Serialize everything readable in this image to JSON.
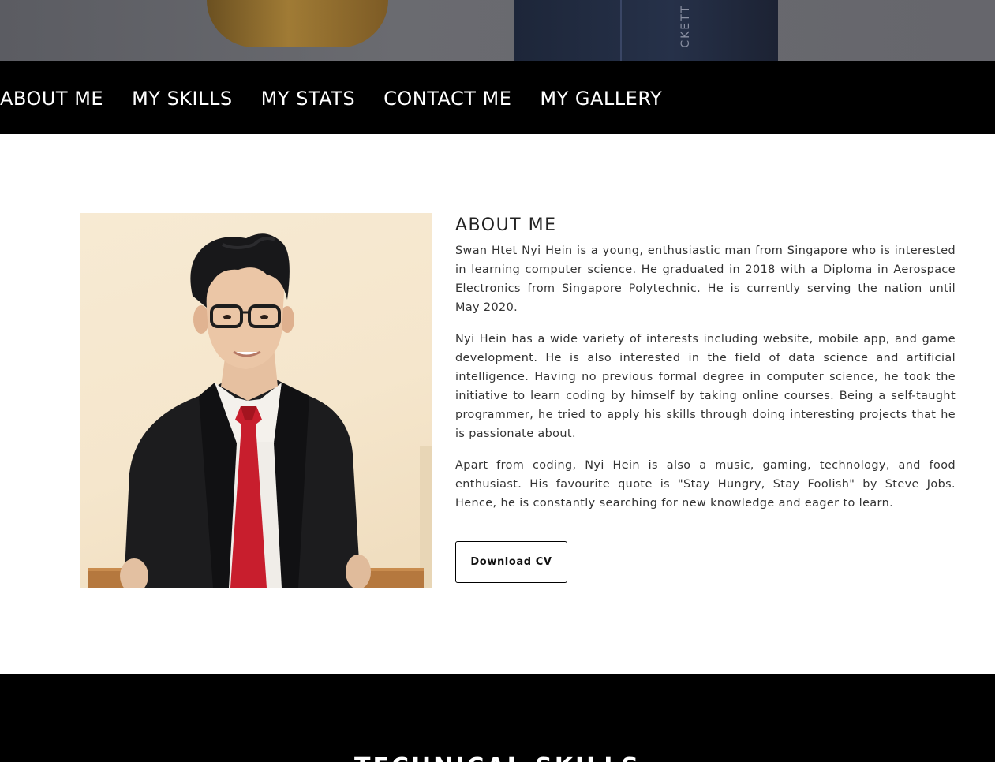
{
  "hero": {
    "book_spine_text": "CKETT"
  },
  "nav": {
    "items": [
      {
        "label": "ABOUT ME"
      },
      {
        "label": "MY SKILLS"
      },
      {
        "label": "MY STATS"
      },
      {
        "label": "CONTACT ME"
      },
      {
        "label": "MY GALLERY"
      }
    ]
  },
  "about": {
    "title": "ABOUT ME",
    "paragraphs": [
      "Swan Htet Nyi Hein is a young, enthusiastic man from Singapore who is interested in learning computer science. He graduated in 2018 with a Diploma in Aerospace Electronics from Singapore Polytechnic. He is currently serving the nation until May 2020.",
      "Nyi Hein has a wide variety of interests including website, mobile app, and game development. He is also interested in the field of data science and artificial intelligence. Having no previous formal degree in computer science, he took the initiative to learn coding by himself by taking online courses. Being a self-taught programmer, he tried to apply his skills through doing interesting projects that he is passionate about.",
      "Apart from coding, Nyi Hein is also a music, gaming, technology, and food enthusiast. His favourite quote is \"Stay Hungry, Stay Foolish\" by Steve Jobs. Hence, he is constantly searching for new knowledge and eager to learn."
    ],
    "cv_button_label": "Download CV"
  },
  "skills": {
    "title": "TECHNICAL SKILLS"
  },
  "colors": {
    "nav_background": "#000000",
    "nav_text": "#ffffff",
    "page_background": "#ffffff",
    "text": "#333333"
  }
}
